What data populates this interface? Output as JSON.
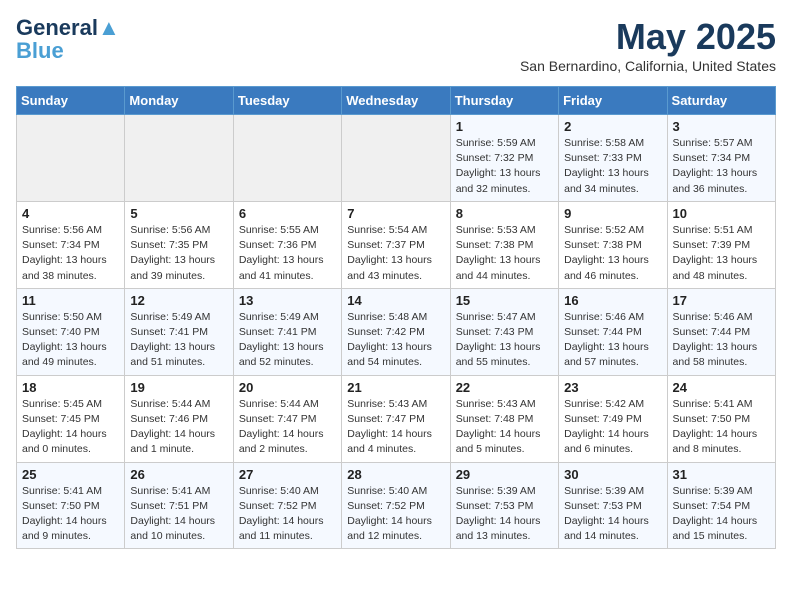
{
  "header": {
    "logo_line1": "General",
    "logo_line2": "Blue",
    "month": "May 2025",
    "location": "San Bernardino, California, United States"
  },
  "weekdays": [
    "Sunday",
    "Monday",
    "Tuesday",
    "Wednesday",
    "Thursday",
    "Friday",
    "Saturday"
  ],
  "weeks": [
    [
      {
        "day": "",
        "detail": ""
      },
      {
        "day": "",
        "detail": ""
      },
      {
        "day": "",
        "detail": ""
      },
      {
        "day": "",
        "detail": ""
      },
      {
        "day": "1",
        "detail": "Sunrise: 5:59 AM\nSunset: 7:32 PM\nDaylight: 13 hours\nand 32 minutes."
      },
      {
        "day": "2",
        "detail": "Sunrise: 5:58 AM\nSunset: 7:33 PM\nDaylight: 13 hours\nand 34 minutes."
      },
      {
        "day": "3",
        "detail": "Sunrise: 5:57 AM\nSunset: 7:34 PM\nDaylight: 13 hours\nand 36 minutes."
      }
    ],
    [
      {
        "day": "4",
        "detail": "Sunrise: 5:56 AM\nSunset: 7:34 PM\nDaylight: 13 hours\nand 38 minutes."
      },
      {
        "day": "5",
        "detail": "Sunrise: 5:56 AM\nSunset: 7:35 PM\nDaylight: 13 hours\nand 39 minutes."
      },
      {
        "day": "6",
        "detail": "Sunrise: 5:55 AM\nSunset: 7:36 PM\nDaylight: 13 hours\nand 41 minutes."
      },
      {
        "day": "7",
        "detail": "Sunrise: 5:54 AM\nSunset: 7:37 PM\nDaylight: 13 hours\nand 43 minutes."
      },
      {
        "day": "8",
        "detail": "Sunrise: 5:53 AM\nSunset: 7:38 PM\nDaylight: 13 hours\nand 44 minutes."
      },
      {
        "day": "9",
        "detail": "Sunrise: 5:52 AM\nSunset: 7:38 PM\nDaylight: 13 hours\nand 46 minutes."
      },
      {
        "day": "10",
        "detail": "Sunrise: 5:51 AM\nSunset: 7:39 PM\nDaylight: 13 hours\nand 48 minutes."
      }
    ],
    [
      {
        "day": "11",
        "detail": "Sunrise: 5:50 AM\nSunset: 7:40 PM\nDaylight: 13 hours\nand 49 minutes."
      },
      {
        "day": "12",
        "detail": "Sunrise: 5:49 AM\nSunset: 7:41 PM\nDaylight: 13 hours\nand 51 minutes."
      },
      {
        "day": "13",
        "detail": "Sunrise: 5:49 AM\nSunset: 7:41 PM\nDaylight: 13 hours\nand 52 minutes."
      },
      {
        "day": "14",
        "detail": "Sunrise: 5:48 AM\nSunset: 7:42 PM\nDaylight: 13 hours\nand 54 minutes."
      },
      {
        "day": "15",
        "detail": "Sunrise: 5:47 AM\nSunset: 7:43 PM\nDaylight: 13 hours\nand 55 minutes."
      },
      {
        "day": "16",
        "detail": "Sunrise: 5:46 AM\nSunset: 7:44 PM\nDaylight: 13 hours\nand 57 minutes."
      },
      {
        "day": "17",
        "detail": "Sunrise: 5:46 AM\nSunset: 7:44 PM\nDaylight: 13 hours\nand 58 minutes."
      }
    ],
    [
      {
        "day": "18",
        "detail": "Sunrise: 5:45 AM\nSunset: 7:45 PM\nDaylight: 14 hours\nand 0 minutes."
      },
      {
        "day": "19",
        "detail": "Sunrise: 5:44 AM\nSunset: 7:46 PM\nDaylight: 14 hours\nand 1 minute."
      },
      {
        "day": "20",
        "detail": "Sunrise: 5:44 AM\nSunset: 7:47 PM\nDaylight: 14 hours\nand 2 minutes."
      },
      {
        "day": "21",
        "detail": "Sunrise: 5:43 AM\nSunset: 7:47 PM\nDaylight: 14 hours\nand 4 minutes."
      },
      {
        "day": "22",
        "detail": "Sunrise: 5:43 AM\nSunset: 7:48 PM\nDaylight: 14 hours\nand 5 minutes."
      },
      {
        "day": "23",
        "detail": "Sunrise: 5:42 AM\nSunset: 7:49 PM\nDaylight: 14 hours\nand 6 minutes."
      },
      {
        "day": "24",
        "detail": "Sunrise: 5:41 AM\nSunset: 7:50 PM\nDaylight: 14 hours\nand 8 minutes."
      }
    ],
    [
      {
        "day": "25",
        "detail": "Sunrise: 5:41 AM\nSunset: 7:50 PM\nDaylight: 14 hours\nand 9 minutes."
      },
      {
        "day": "26",
        "detail": "Sunrise: 5:41 AM\nSunset: 7:51 PM\nDaylight: 14 hours\nand 10 minutes."
      },
      {
        "day": "27",
        "detail": "Sunrise: 5:40 AM\nSunset: 7:52 PM\nDaylight: 14 hours\nand 11 minutes."
      },
      {
        "day": "28",
        "detail": "Sunrise: 5:40 AM\nSunset: 7:52 PM\nDaylight: 14 hours\nand 12 minutes."
      },
      {
        "day": "29",
        "detail": "Sunrise: 5:39 AM\nSunset: 7:53 PM\nDaylight: 14 hours\nand 13 minutes."
      },
      {
        "day": "30",
        "detail": "Sunrise: 5:39 AM\nSunset: 7:53 PM\nDaylight: 14 hours\nand 14 minutes."
      },
      {
        "day": "31",
        "detail": "Sunrise: 5:39 AM\nSunset: 7:54 PM\nDaylight: 14 hours\nand 15 minutes."
      }
    ]
  ]
}
